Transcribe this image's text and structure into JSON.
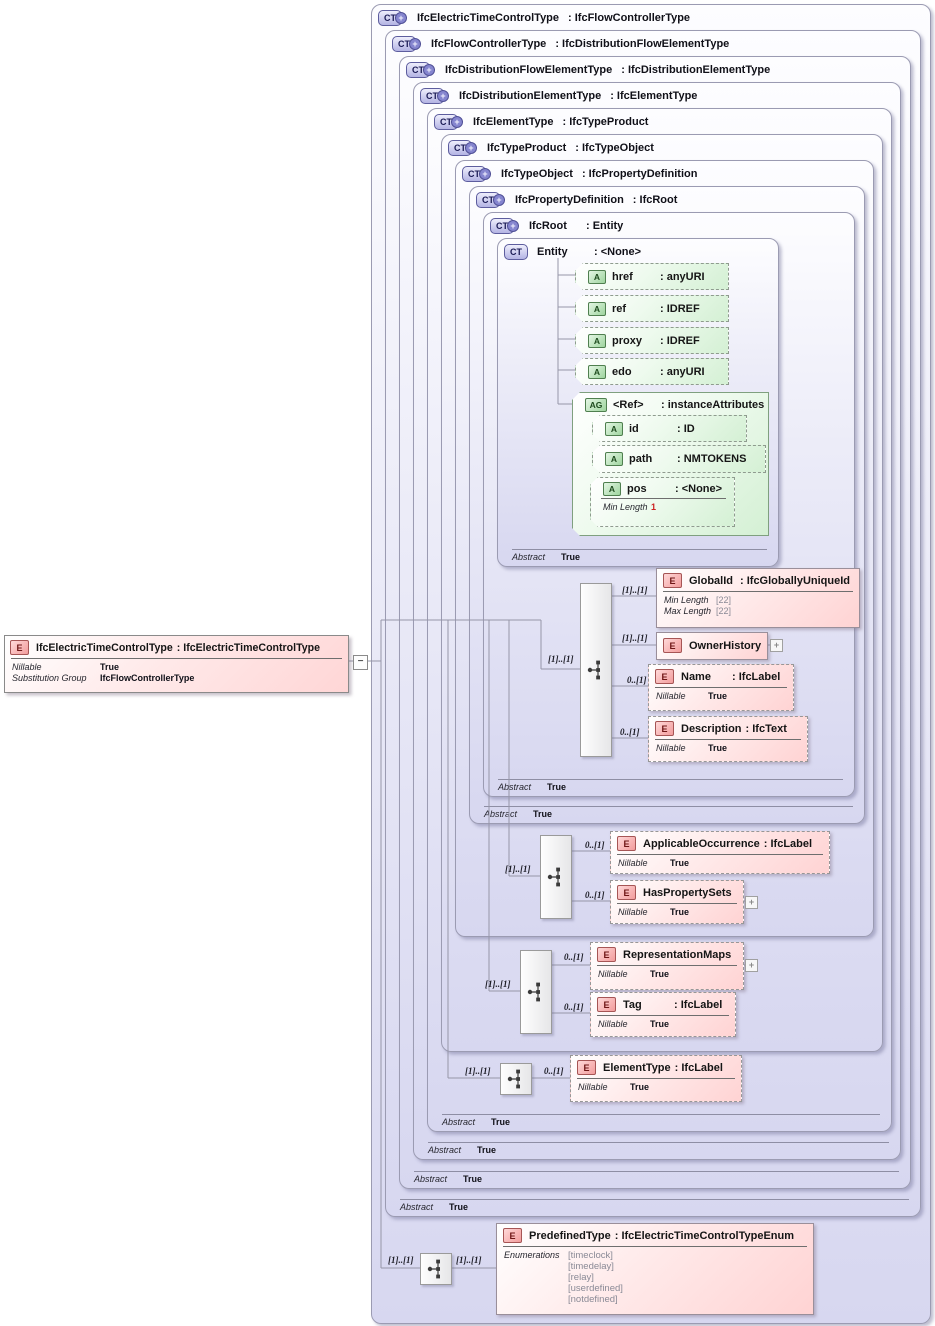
{
  "diagram": {
    "badge_ct": "CT",
    "badge_plus": "+",
    "expander_symbol": "+",
    "collapse_symbol": "−",
    "abstract_label": "Abstract",
    "root_element": {
      "badge": "E",
      "name": "IfcElectricTimeControlType",
      "type": ": IfcElectricTimeControlType",
      "rows": [
        {
          "label": "Nillable",
          "value": "True"
        },
        {
          "label": "Substitution Group",
          "value": "IfcFlowControllerType"
        }
      ]
    },
    "hierarchy": [
      {
        "badge": "CT+",
        "name": "IfcElectricTimeControlType",
        "base": "IfcFlowControllerType",
        "abstract": null
      },
      {
        "badge": "CT+",
        "name": "IfcFlowControllerType",
        "base": "IfcDistributionFlowElementType",
        "abstract": "True"
      },
      {
        "badge": "CT+",
        "name": "IfcDistributionFlowElementType",
        "base": "IfcDistributionElementType",
        "abstract": "True"
      },
      {
        "badge": "CT+",
        "name": "IfcDistributionElementType",
        "base": "IfcElementType",
        "abstract": "True"
      },
      {
        "badge": "CT+",
        "name": "IfcElementType",
        "base": "IfcTypeProduct",
        "abstract": "True"
      },
      {
        "badge": "CT+",
        "name": "IfcTypeProduct",
        "base": "IfcTypeObject",
        "abstract": null
      },
      {
        "badge": "CT+",
        "name": "IfcTypeObject",
        "base": "IfcPropertyDefinition",
        "abstract": null
      },
      {
        "badge": "CT+",
        "name": "IfcPropertyDefinition",
        "base": "IfcRoot",
        "abstract": "True"
      },
      {
        "badge": "CT+",
        "name": "IfcRoot",
        "base": "Entity",
        "abstract": "True"
      },
      {
        "badge": "CT",
        "name": "Entity",
        "base": "<None>",
        "abstract": "True"
      }
    ],
    "sequences": {
      "s1": "[1]..[1]",
      "s2": "[1]..[1]",
      "s3": "[1]..[1]",
      "s4": "[1]..[1]",
      "s5_left": "[1]..[1]",
      "s5_right": "[1]..[1]"
    },
    "attributes": {
      "href": {
        "badge": "A",
        "name": "href",
        "type": ": anyURI"
      },
      "ref": {
        "badge": "A",
        "name": "ref",
        "type": ": IDREF"
      },
      "proxy": {
        "badge": "A",
        "name": "proxy",
        "type": ": IDREF"
      },
      "edo": {
        "badge": "A",
        "name": "edo",
        "type": ": anyURI"
      },
      "group": {
        "badge": "AG",
        "name": "<Ref>",
        "type": ": instanceAttributes"
      },
      "id": {
        "badge": "A",
        "name": "id",
        "type": ": ID"
      },
      "path": {
        "badge": "A",
        "name": "path",
        "type": ": NMTOKENS"
      },
      "pos": {
        "badge": "A",
        "name": "pos",
        "type": ": <None>",
        "rows": [
          {
            "label": "Min Length",
            "value": "1"
          }
        ]
      }
    },
    "elements": {
      "globalid": {
        "badge": "E",
        "name": "GlobalId",
        "type": ": IfcGloballyUniqueId",
        "card": "[1]..[1]",
        "rows": [
          {
            "label": "Min Length",
            "value": "[22]"
          },
          {
            "label": "Max Length",
            "value": "[22]"
          }
        ]
      },
      "ownerhistory": {
        "badge": "E",
        "name": "OwnerHistory",
        "card": "[1]..[1]"
      },
      "name": {
        "badge": "E",
        "name": "Name",
        "type": ": IfcLabel",
        "card": "0..[1]",
        "rows": [
          {
            "label": "Nillable",
            "value": "True"
          }
        ]
      },
      "description": {
        "badge": "E",
        "name": "Description",
        "type": ": IfcText",
        "card": "0..[1]",
        "rows": [
          {
            "label": "Nillable",
            "value": "True"
          }
        ]
      },
      "applicableoccurrence": {
        "badge": "E",
        "name": "ApplicableOccurrence",
        "type": ": IfcLabel",
        "card": "0..[1]",
        "rows": [
          {
            "label": "Nillable",
            "value": "True"
          }
        ]
      },
      "haspropertysets": {
        "badge": "E",
        "name": "HasPropertySets",
        "card": "0..[1]",
        "rows": [
          {
            "label": "Nillable",
            "value": "True"
          }
        ]
      },
      "representationmaps": {
        "badge": "E",
        "name": "RepresentationMaps",
        "card": "0..[1]",
        "rows": [
          {
            "label": "Nillable",
            "value": "True"
          }
        ]
      },
      "tag": {
        "badge": "E",
        "name": "Tag",
        "type": ": IfcLabel",
        "card": "0..[1]",
        "rows": [
          {
            "label": "Nillable",
            "value": "True"
          }
        ]
      },
      "elementtype": {
        "badge": "E",
        "name": "ElementType",
        "type": ": IfcLabel",
        "card": "0..[1]",
        "rows": [
          {
            "label": "Nillable",
            "value": "True"
          }
        ]
      },
      "predefinedtype": {
        "badge": "E",
        "name": "PredefinedType",
        "type": ": IfcElectricTimeControlTypeEnum",
        "enum_label": "Enumerations",
        "enums": [
          "[timeclock]",
          "[timedelay]",
          "[relay]",
          "[userdefined]",
          "[notdefined]"
        ]
      }
    },
    "colors": {
      "box_lavender": "#d7d7f0",
      "element_pink": "#ffd3d3",
      "attribute_green": "#d4f0d4",
      "badge_blue": "#b4b4e4",
      "line_gray": "#9696a8",
      "enum_text_gray": "#8a8a96",
      "required_red": "#cc2222"
    }
  }
}
